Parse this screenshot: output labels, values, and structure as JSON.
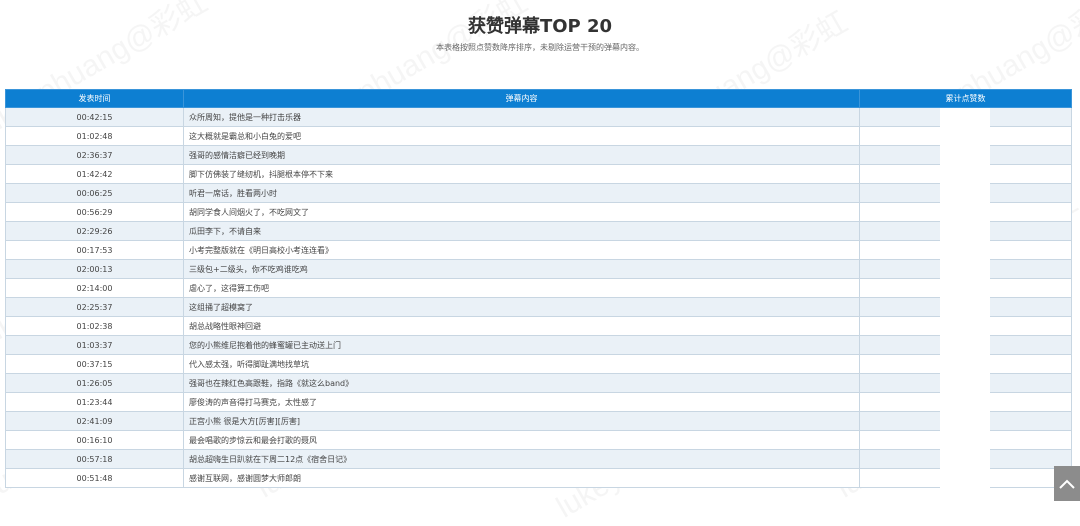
{
  "header": {
    "title": "获赞弹幕TOP 20",
    "subtitle": "本表格按照点赞数降序排序，未剔除运营干预的弹幕内容。"
  },
  "watermark_text": "lukeyphuang@彩虹",
  "table": {
    "columns": [
      "发表时间",
      "弹幕内容",
      "累计点赞数"
    ],
    "rows": [
      {
        "time": "00:42:15",
        "text": "众所周知，提他是一种打击乐器"
      },
      {
        "time": "01:02:48",
        "text": "这大概就是霸总和小白兔的爱吧"
      },
      {
        "time": "02:36:37",
        "text": "强哥的感情洁癖已经到晚期"
      },
      {
        "time": "01:42:42",
        "text": "脚下仿佛装了缝纫机，抖腿根本停不下来"
      },
      {
        "time": "00:06:25",
        "text": "听君一席话，胜看两小时"
      },
      {
        "time": "00:56:29",
        "text": "胡同学食人间烟火了，不吃网文了"
      },
      {
        "time": "02:29:26",
        "text": "瓜田李下，不请自来"
      },
      {
        "time": "00:17:53",
        "text": "小考完整版就在《明日高校小考连连看》"
      },
      {
        "time": "02:00:13",
        "text": "三级包+二级头，你不吃鸡谁吃鸡"
      },
      {
        "time": "02:14:00",
        "text": "虐心了，这得算工伤吧"
      },
      {
        "time": "02:25:37",
        "text": "这组捅了超模窝了"
      },
      {
        "time": "01:02:38",
        "text": "胡总战略性眼神回避"
      },
      {
        "time": "01:03:37",
        "text": "您的小熊维尼抱着他的蜂蜜罐已主动送上门"
      },
      {
        "time": "00:37:15",
        "text": "代入感太强，听得脚趾满地找草坑"
      },
      {
        "time": "01:26:05",
        "text": "强哥也在辣红色高跟鞋，指路《就这么band》"
      },
      {
        "time": "01:23:44",
        "text": "廖俊涛的声音得打马赛克，太性感了"
      },
      {
        "time": "02:41:09",
        "text": "正宫小熊 很是大方[厉害][厉害]"
      },
      {
        "time": "00:16:10",
        "text": "最会唱歌的步惊云和最会打歌的聂风"
      },
      {
        "time": "00:57:18",
        "text": "胡总超嗨生日趴就在下周二12点《宿舍日记》"
      },
      {
        "time": "00:51:48",
        "text": "感谢互联网，感谢圆梦大师郎朗"
      }
    ]
  },
  "colors": {
    "header_bg": "#0d7fd2",
    "row_alt_bg": "#eaf1f7",
    "scroll_top_bg": "#8c8c8c"
  },
  "icons": {
    "scroll_top": "chevron-up-icon"
  }
}
